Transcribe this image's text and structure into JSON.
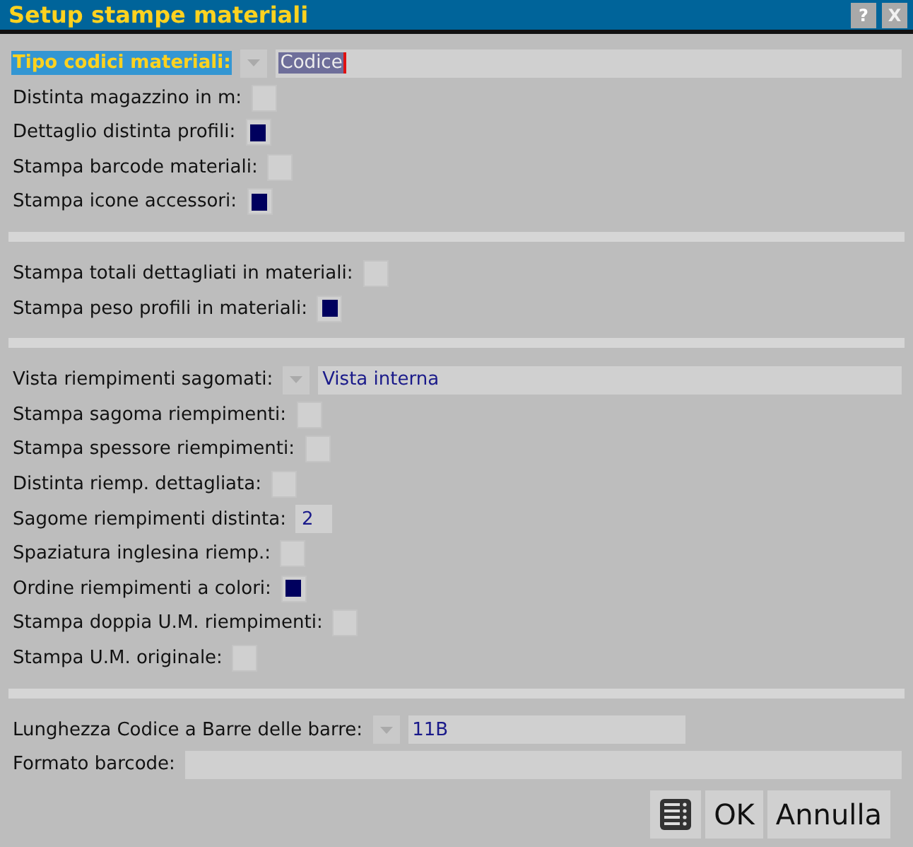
{
  "window": {
    "title": "Setup stampe materiali",
    "buttons": [
      {
        "kind": "help",
        "label": "?"
      },
      {
        "kind": "close",
        "label": "X"
      }
    ]
  },
  "sections": [
    [
      {
        "kind": "combo",
        "label": "Tipo codici materiali:",
        "value": "Codice",
        "focused": true
      },
      {
        "kind": "checkbox",
        "label": "Distinta magazzino in m:",
        "checked": false
      },
      {
        "kind": "checkbox",
        "label": "Dettaglio distinta profili:",
        "checked": true
      },
      {
        "kind": "checkbox",
        "label": "Stampa barcode materiali:",
        "checked": false
      },
      {
        "kind": "checkbox",
        "label": "Stampa icone accessori:",
        "checked": true
      }
    ],
    [
      {
        "kind": "checkbox",
        "label": "Stampa totali dettagliati in materiali:",
        "checked": false
      },
      {
        "kind": "checkbox",
        "label": "Stampa peso profili in materiali:",
        "checked": true
      }
    ],
    [
      {
        "kind": "combo",
        "label": "Vista riempimenti sagomati:",
        "value": "Vista interna",
        "focused": false
      },
      {
        "kind": "checkbox",
        "label": "Stampa sagoma riempimenti:",
        "checked": false
      },
      {
        "kind": "checkbox",
        "label": "Stampa spessore riempimenti:",
        "checked": false
      },
      {
        "kind": "checkbox",
        "label": "Distinta riemp. dettagliata:",
        "checked": false
      },
      {
        "kind": "number",
        "label": "Sagome riempimenti distinta:",
        "value": "2"
      },
      {
        "kind": "checkbox",
        "label": "Spaziatura inglesina riemp.:",
        "checked": false
      },
      {
        "kind": "checkbox",
        "label": "Ordine riempimenti a colori:",
        "checked": true
      },
      {
        "kind": "checkbox",
        "label": "Stampa doppia U.M. riempimenti:",
        "checked": false
      },
      {
        "kind": "checkbox",
        "label": "Stampa U.M. originale:",
        "checked": false
      }
    ],
    [
      {
        "kind": "combo",
        "label": "Lunghezza Codice a Barre delle barre:",
        "value": "11B",
        "focused": false
      },
      {
        "kind": "text",
        "label": "Formato barcode:"
      }
    ]
  ],
  "footer": {
    "buttons": [
      {
        "kind": "icon"
      },
      {
        "kind": "text",
        "label": "OK"
      },
      {
        "kind": "text",
        "label": "Annulla"
      }
    ]
  }
}
